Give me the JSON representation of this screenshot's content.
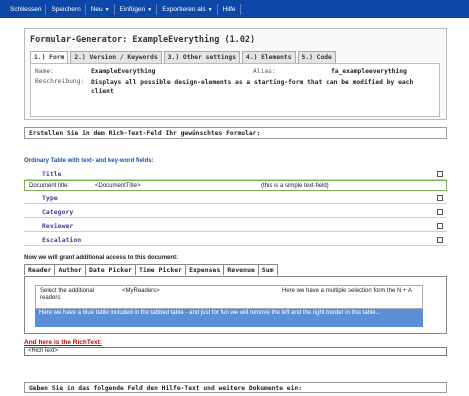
{
  "toolbar": {
    "close": "Schliessen",
    "save": "Speichern",
    "new": "Neu",
    "insert": "Einfügen",
    "export": "Exportieren als",
    "help": "Hilfe"
  },
  "form": {
    "title": "Formular-Generator: ExampleEverything (1.02)",
    "tabs": [
      "1.) Form",
      "2.) Version / Keywords",
      "3.) Other settings",
      "4.) Elements",
      "5.) Code"
    ],
    "name_label": "Name:",
    "name_value": "ExampleEverything",
    "alias_label": "Alias:",
    "alias_value": "fa_exampleeverything",
    "desc_label": "Beschreibung:",
    "desc_value": "Displays all possible design-elements as a starting-form that can be modified by each client"
  },
  "rt_heading": "Erstellen Sie in dem Rich-Text-Feld Ihr gewünschtes Formular:",
  "rt": {
    "table_caption": "Ordinary Table with text- and key-word fields:",
    "sections": [
      "Title",
      "Type",
      "Category",
      "Reviewer",
      "Escalation"
    ],
    "doc_title_label": "Document title:",
    "doc_title_value": "<DocumentTitle>",
    "doc_title_note": "(this is a simple text-field)"
  },
  "access_text": "Now we will grant additional access to this document:",
  "tabs2": [
    "Reader",
    "Author",
    "Date Picker",
    "Time Picker",
    "Expenses",
    "Revenue",
    "Sum"
  ],
  "reader": {
    "select_label": "Select the additional readers",
    "readers_field": "<MyReaders>",
    "note": "Here we have a multiple selection form the N + A",
    "blue_note": "Here we have a blue table included in the tabbed table - and just for fun we will remove the left and the right border in this table..."
  },
  "richtext_label": "And here is the RichText:",
  "richtext_value": "<RichText>",
  "help_heading": "Geben Sie in das folgende Feld den Hilfe-Text und weitere Dokumente ein:",
  "colors": {
    "toolbar": "#0d48a8",
    "blue_table": "#5a8fd8",
    "accent_red": "#cc0000"
  }
}
